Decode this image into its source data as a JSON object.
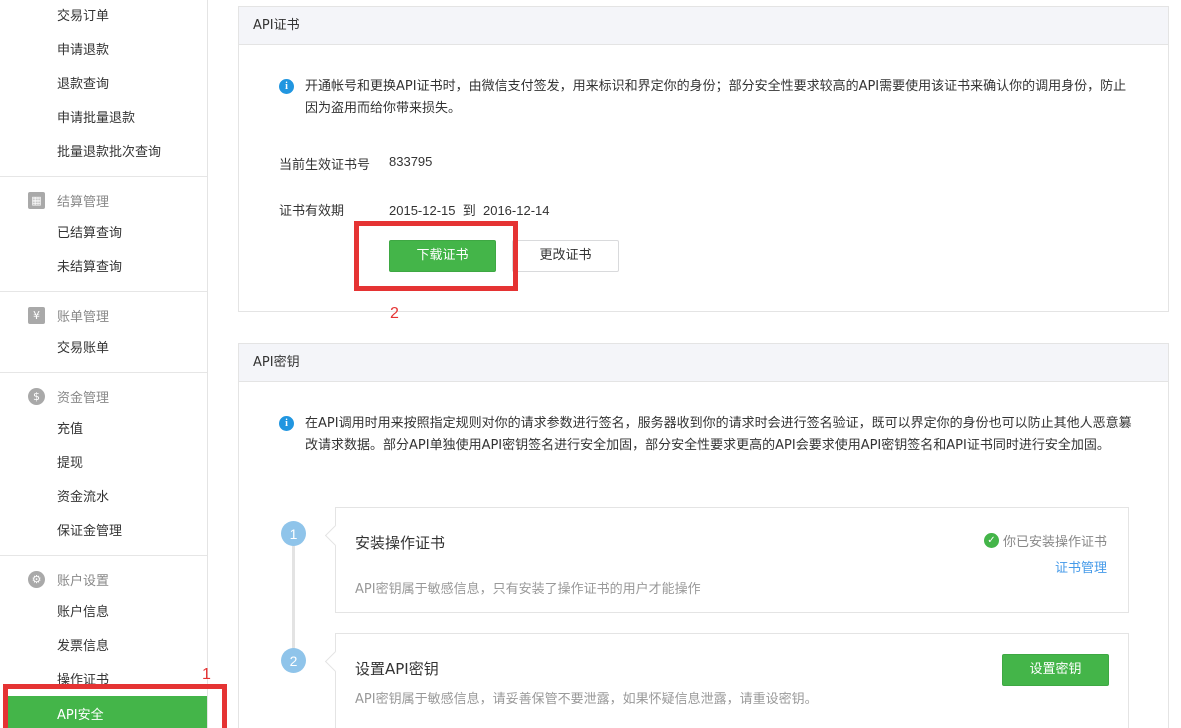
{
  "sidebar": {
    "trade_items": [
      "交易订单",
      "申请退款",
      "退款查询",
      "申请批量退款",
      "批量退款批次查询"
    ],
    "settlement": {
      "title": "结算管理",
      "icon": "calculator-icon",
      "items": [
        "已结算查询",
        "未结算查询"
      ]
    },
    "bills": {
      "title": "账单管理",
      "icon": "yen-icon",
      "items": [
        "交易账单"
      ]
    },
    "funds": {
      "title": "资金管理",
      "icon": "money-bag-icon",
      "items": [
        "充值",
        "提现",
        "资金流水",
        "保证金管理"
      ]
    },
    "account": {
      "title": "账户设置",
      "icon": "gear-icon",
      "items": [
        "账户信息",
        "发票信息",
        "操作证书"
      ]
    },
    "active_item": "API安全"
  },
  "annotations": {
    "marker1": "1",
    "marker2": "2",
    "color": "#e53333"
  },
  "cert_panel": {
    "title": "API证书",
    "info": "开通帐号和更换API证书时，由微信支付签发，用来标识和界定你的身份；部分安全性要求较高的API需要使用该证书来确认你的调用身份，防止因为盗用而给你带来损失。",
    "cert_no_label": "当前生效证书号",
    "cert_no": "833795",
    "validity_label": "证书有效期",
    "validity_from": "2015-12-15",
    "validity_to_word": "到",
    "validity_to": "2016-12-14",
    "download_button": "下载证书",
    "change_button": "更改证书"
  },
  "key_panel": {
    "title": "API密钥",
    "info": "在API调用时用来按照指定规则对你的请求参数进行签名，服务器收到你的请求时会进行签名验证，既可以界定你的身份也可以防止其他人恶意篡改请求数据。部分API单独使用API密钥签名进行安全加固，部分安全性要求更高的API会要求使用API密钥签名和API证书同时进行安全加固。",
    "steps": [
      {
        "num": "1",
        "title": "安装操作证书",
        "desc": "API密钥属于敏感信息，只有安装了操作证书的用户才能操作",
        "status": "你已安装操作证书",
        "link": "证书管理"
      },
      {
        "num": "2",
        "title": "设置API密钥",
        "desc": "API密钥属于敏感信息，请妥善保管不要泄露，如果怀疑信息泄露，请重设密钥。",
        "button": "设置密钥"
      }
    ]
  },
  "colors": {
    "accent": "#44b549",
    "info": "#2196e0",
    "link": "#459ae9",
    "step": "#8fc4ea"
  }
}
